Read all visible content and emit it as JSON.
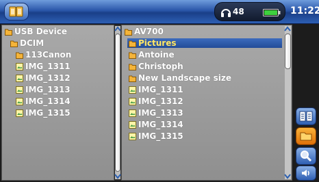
{
  "status": {
    "volume": "48",
    "time": "11:22"
  },
  "left_panel": {
    "items": [
      {
        "label": "USB Device",
        "type": "folder"
      },
      {
        "label": "DCIM",
        "type": "folder"
      },
      {
        "label": "113Canon",
        "type": "folder"
      },
      {
        "label": "IMG_1311",
        "type": "image"
      },
      {
        "label": "IMG_1312",
        "type": "image"
      },
      {
        "label": "IMG_1313",
        "type": "image"
      },
      {
        "label": "IMG_1314",
        "type": "image"
      },
      {
        "label": "IMG_1315",
        "type": "image"
      }
    ]
  },
  "right_panel": {
    "items": [
      {
        "label": "AV700",
        "type": "folder"
      },
      {
        "label": "Pictures",
        "type": "folder",
        "selected": true
      },
      {
        "label": "Antoine",
        "type": "folder"
      },
      {
        "label": "Christoph",
        "type": "folder"
      },
      {
        "label": "New Landscape size",
        "type": "folder"
      },
      {
        "label": "IMG_1311",
        "type": "image"
      },
      {
        "label": "IMG_1312",
        "type": "image"
      },
      {
        "label": "IMG_1313",
        "type": "image"
      },
      {
        "label": "IMG_1314",
        "type": "image"
      },
      {
        "label": "IMG_1315",
        "type": "image"
      }
    ]
  },
  "side_buttons": [
    {
      "icon": "dual-panel-icon"
    },
    {
      "icon": "folder-icon",
      "active": true
    },
    {
      "icon": "search-icon"
    },
    {
      "icon": "speaker-icon"
    }
  ],
  "colors": {
    "top_bar": "#2a56a9",
    "panel_bg": "#9e9e9e",
    "selection": "#2f5cab",
    "selected_text": "#ffe86a",
    "active_button": "#f0901e"
  }
}
